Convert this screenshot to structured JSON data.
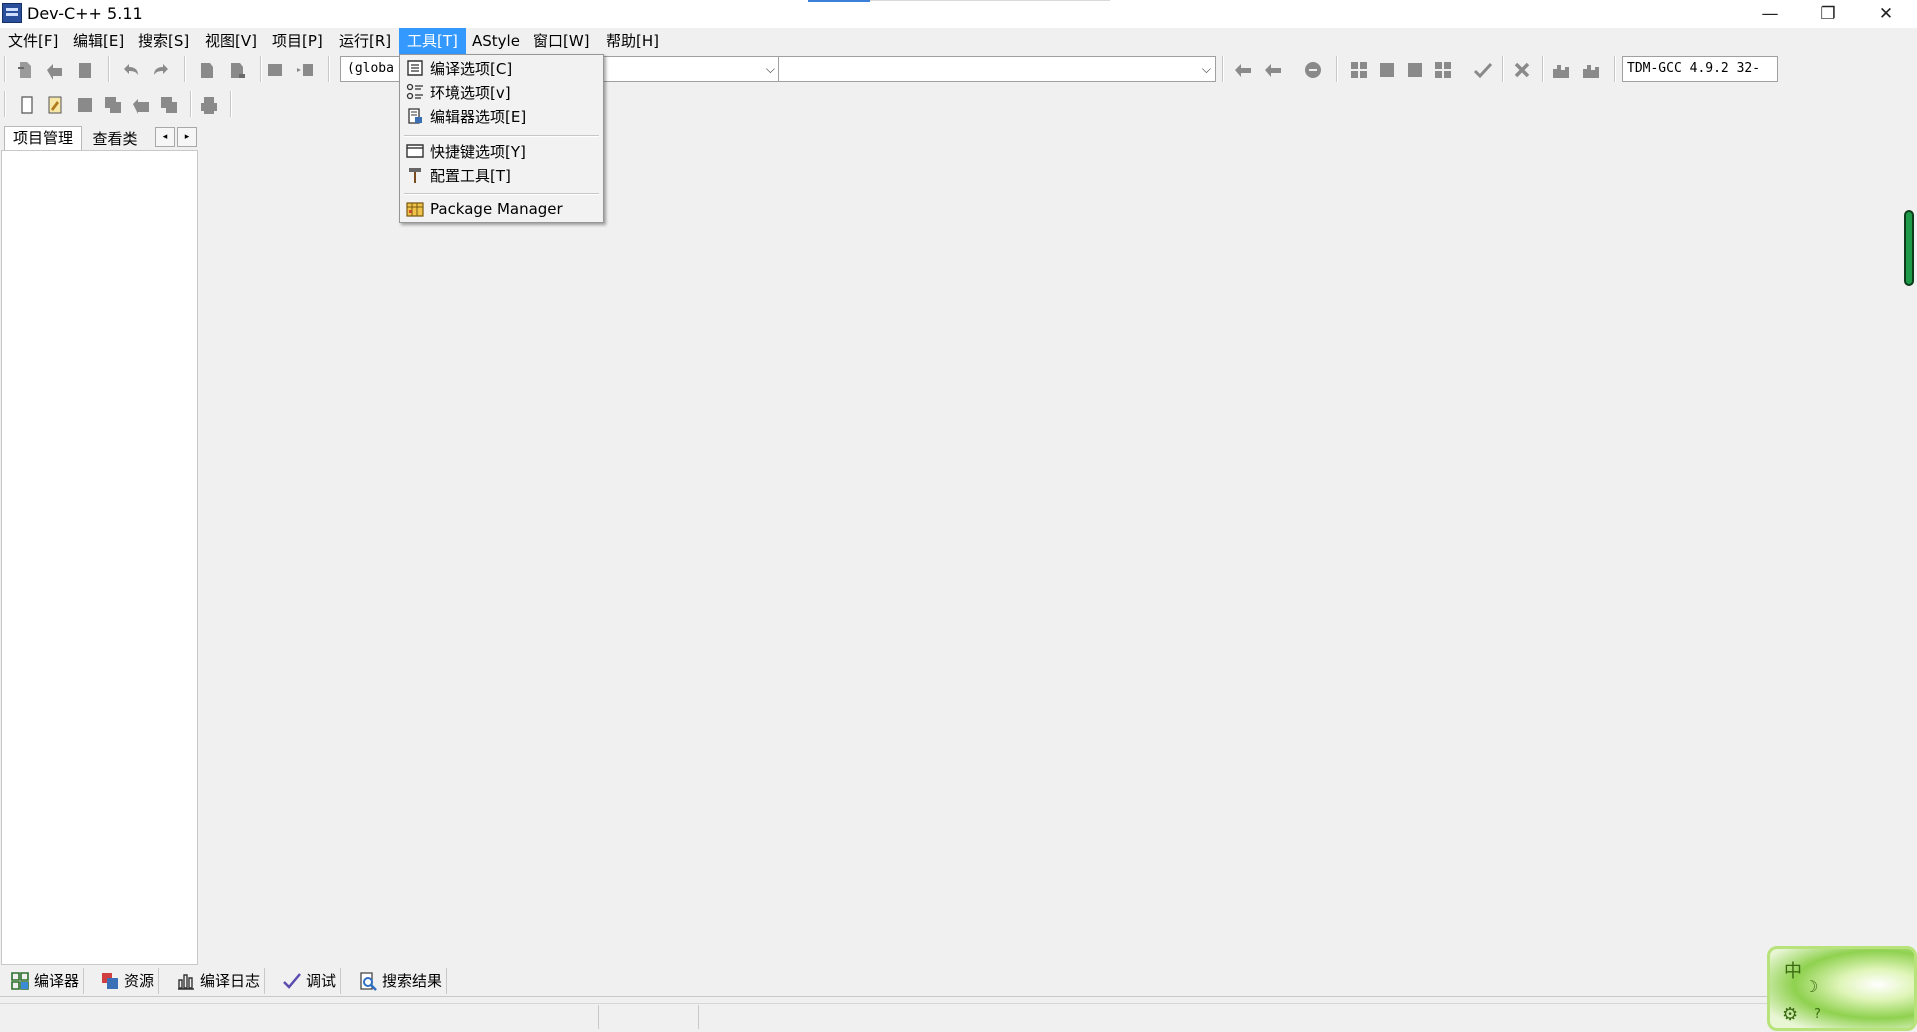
{
  "window": {
    "title": "Dev-C++ 5.11",
    "controls": {
      "minimize": "—",
      "maximize": "❐",
      "close": "✕"
    }
  },
  "menubar": {
    "items": [
      {
        "label": "文件[F]"
      },
      {
        "label": "编辑[E]"
      },
      {
        "label": "搜索[S]"
      },
      {
        "label": "视图[V]"
      },
      {
        "label": "项目[P]"
      },
      {
        "label": "运行[R]"
      },
      {
        "label": "工具[T]",
        "active": true
      },
      {
        "label": "AStyle"
      },
      {
        "label": "窗口[W]"
      },
      {
        "label": "帮助[H]"
      }
    ]
  },
  "tools_menu": {
    "items": [
      {
        "label": "编译选项[C]",
        "icon": "compiler-options-icon"
      },
      {
        "label": "环境选项[v]",
        "icon": "environment-options-icon"
      },
      {
        "label": "编辑器选项[E]",
        "icon": "editor-options-icon"
      },
      {
        "label": "快捷键选项[Y]",
        "icon": "shortcut-options-icon"
      },
      {
        "label": "配置工具[T]",
        "icon": "hammer-icon"
      },
      {
        "label": "Package Manager",
        "icon": "package-icon"
      }
    ]
  },
  "toolbar": {
    "scope_combo": "(globa",
    "compiler_combo": "TDM-GCC 4.9.2 32-",
    "combo_arrow": "⌵"
  },
  "left_panel": {
    "tabs": [
      "项目管理",
      "查看类"
    ],
    "scroll_left": "◂",
    "scroll_right": "▸"
  },
  "bottom_tabs": [
    {
      "label": "编译器",
      "icon": "compiler-grid-icon"
    },
    {
      "label": "资源",
      "icon": "resources-icon"
    },
    {
      "label": "编译日志",
      "icon": "bar-chart-icon"
    },
    {
      "label": "调试",
      "icon": "checkmark-icon"
    },
    {
      "label": "搜索结果",
      "icon": "search-results-icon"
    }
  ],
  "ime": {
    "lang": "中",
    "mode": "☽",
    "settings": "⚙",
    "help": "?"
  },
  "colors": {
    "menu_highlight": "#3399ff",
    "ime_green": "#8fd14f",
    "indicator_green": "#1f9a4a"
  }
}
